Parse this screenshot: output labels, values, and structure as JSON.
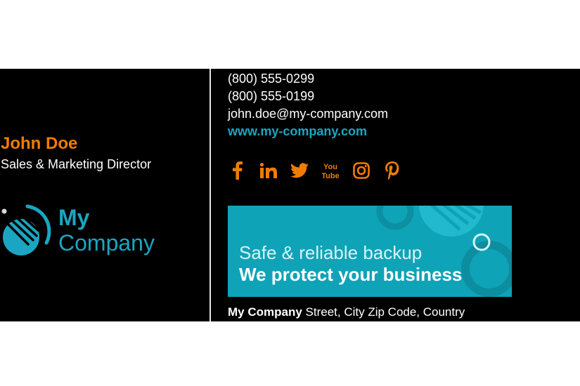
{
  "person": {
    "name": "John Doe",
    "title": "Sales & Marketing Director"
  },
  "logo": {
    "line1": "My",
    "line2": "Company"
  },
  "contact": {
    "phone1": "(800) 555-0299",
    "phone2": "(800) 555-0199",
    "email": "john.doe@my-company.com",
    "website": "www.my-company.com"
  },
  "social": [
    {
      "icon": "facebook-icon"
    },
    {
      "icon": "linkedin-icon"
    },
    {
      "icon": "twitter-icon"
    },
    {
      "icon": "youtube-icon",
      "label_top": "You",
      "label_bottom": "Tube"
    },
    {
      "icon": "instagram-icon"
    },
    {
      "icon": "pinterest-icon"
    }
  ],
  "banner": {
    "line1": "Safe & reliable backup",
    "line2": "We protect your business"
  },
  "address": {
    "company": "My Company",
    "rest": " Street, City Zip Code, Country"
  },
  "colors": {
    "accent_orange": "#f07c00",
    "brand_teal": "#1aa6c2",
    "background": "#000000",
    "banner": "#0fa3b7"
  }
}
